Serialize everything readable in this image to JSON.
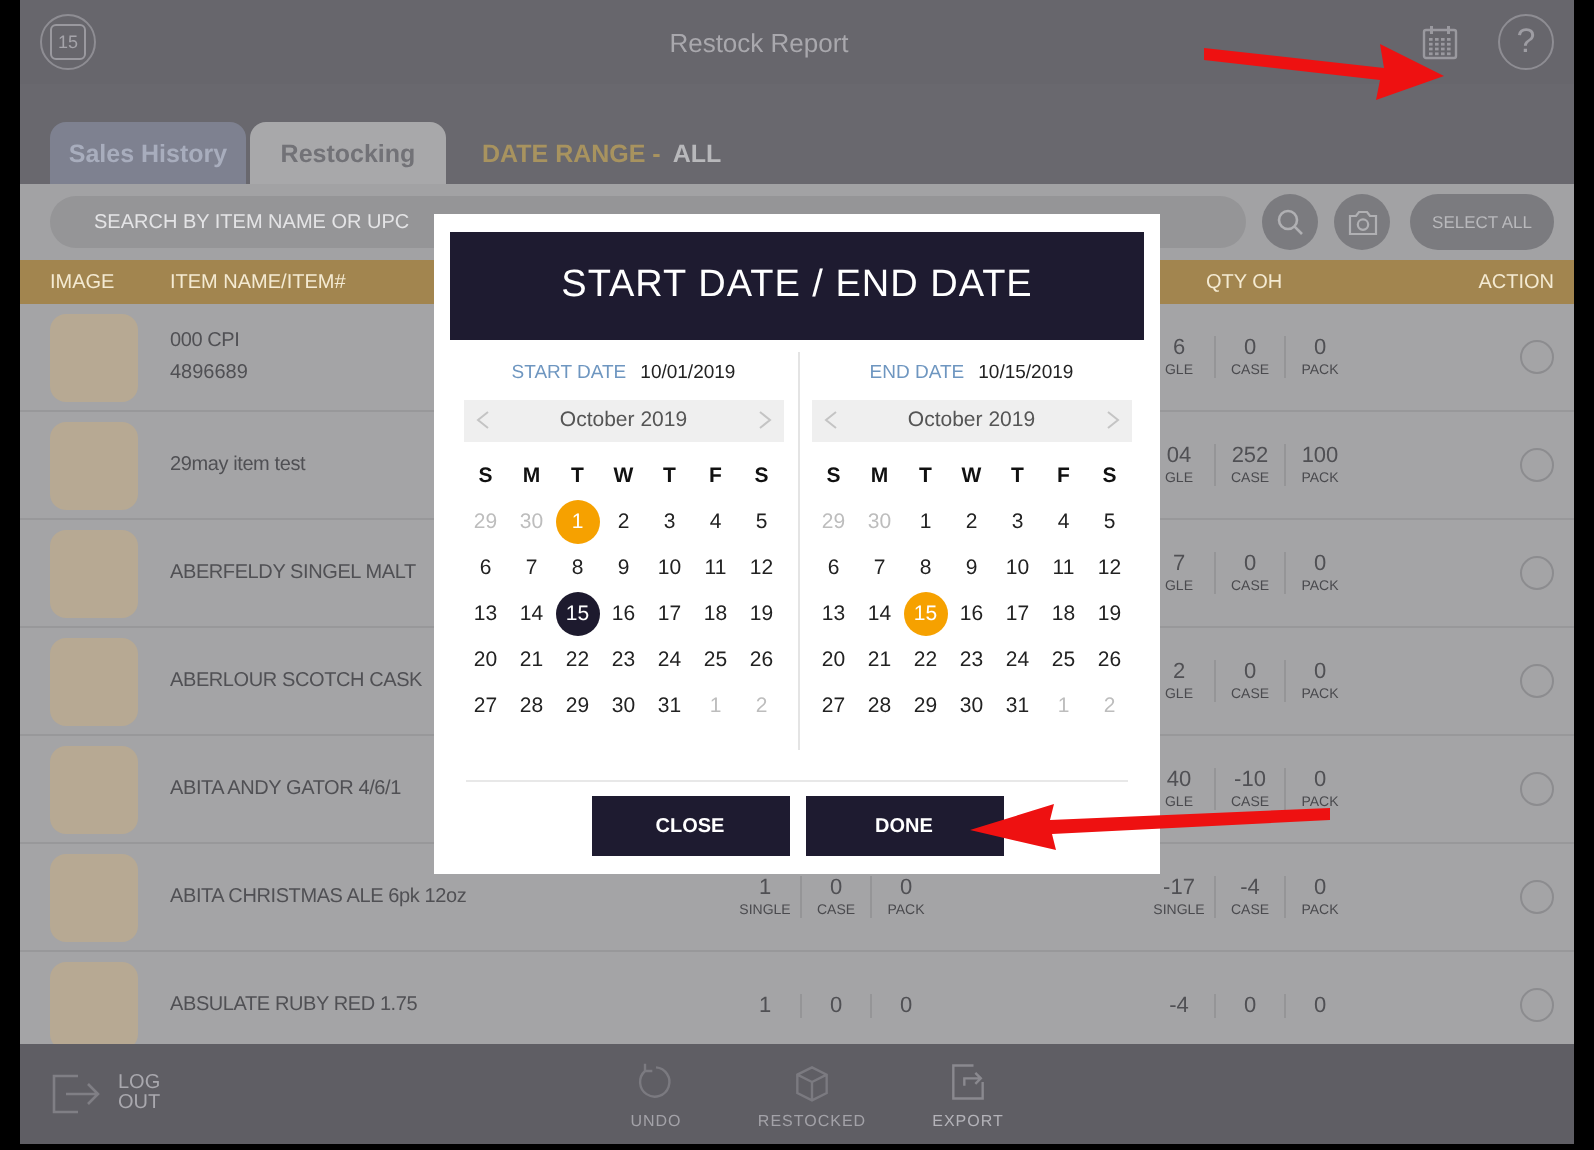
{
  "header": {
    "calendar_day": "15",
    "title": "Restock Report",
    "help": "?"
  },
  "tabs": [
    {
      "label": "Sales History",
      "selected": false
    },
    {
      "label": "Restocking",
      "selected": true
    }
  ],
  "date_range": {
    "label": "DATE RANGE -",
    "value": "ALL"
  },
  "search": {
    "placeholder": "SEARCH BY ITEM NAME OR UPC",
    "select_all": "SELECT ALL"
  },
  "table": {
    "columns": [
      "IMAGE",
      "ITEM NAME/ITEM#",
      "QTY OH",
      "ACTION"
    ],
    "rows": [
      {
        "selected": false,
        "name": "000 CPI",
        "number": "4896689",
        "left_qty": [],
        "right_qty": [
          {
            "value": "6",
            "label": "GLE"
          },
          {
            "value": "0",
            "label": "CASE"
          },
          {
            "value": "0",
            "label": "PACK"
          }
        ]
      },
      {
        "selected": false,
        "name": "29may item test",
        "left_qty": [],
        "right_qty": [
          {
            "value": "04",
            "label": "GLE"
          },
          {
            "value": "252",
            "label": "CASE"
          },
          {
            "value": "100",
            "label": "PACK"
          }
        ]
      },
      {
        "selected": false,
        "name": "ABERFELDY SINGEL MALT",
        "left_qty": [],
        "right_qty": [
          {
            "value": "7",
            "label": "GLE"
          },
          {
            "value": "0",
            "label": "CASE"
          },
          {
            "value": "0",
            "label": "PACK"
          }
        ]
      },
      {
        "selected": false,
        "name": "ABERLOUR SCOTCH  CASK",
        "left_qty": [],
        "right_qty": [
          {
            "value": "2",
            "label": "GLE"
          },
          {
            "value": "0",
            "label": "CASE"
          },
          {
            "value": "0",
            "label": "PACK"
          }
        ]
      },
      {
        "selected": false,
        "name": "ABITA ANDY GATOR 4/6/1",
        "left_qty": [],
        "right_qty": [
          {
            "value": "40",
            "label": "GLE"
          },
          {
            "value": "-10",
            "label": "CASE"
          },
          {
            "value": "0",
            "label": "PACK"
          }
        ]
      },
      {
        "selected": false,
        "name": "ABITA CHRISTMAS  ALE 6pk 12oz",
        "left_qty": [
          {
            "value": "1",
            "label": "SINGLE"
          },
          {
            "value": "0",
            "label": "CASE"
          },
          {
            "value": "0",
            "label": "PACK"
          }
        ],
        "right_qty": [
          {
            "value": "-17",
            "label": "SINGLE"
          },
          {
            "value": "-4",
            "label": "CASE"
          },
          {
            "value": "0",
            "label": "PACK"
          }
        ]
      },
      {
        "selected": false,
        "name": "ABSULATE RUBY RED 1.75",
        "left_qty": [
          {
            "value": "1"
          },
          {
            "value": "0"
          },
          {
            "value": "0"
          }
        ],
        "right_qty": [
          {
            "value": "-4"
          },
          {
            "value": "0"
          },
          {
            "value": "0"
          }
        ]
      }
    ]
  },
  "dialog": {
    "title": "START DATE / END DATE",
    "calendars": [
      {
        "label": "START DATE",
        "value": "10/01/2019",
        "month": "October 2019",
        "weekdays": [
          "S",
          "M",
          "T",
          "W",
          "T",
          "F",
          "S"
        ],
        "days": [
          {
            "day": "29",
            "outside": true,
            "selected": false,
            "today": false
          },
          {
            "day": "30",
            "outside": true,
            "selected": false,
            "today": false
          },
          {
            "day": "1",
            "outside": false,
            "selected": true,
            "today": false
          },
          {
            "day": "2",
            "outside": false,
            "selected": false,
            "today": false
          },
          {
            "day": "3",
            "outside": false,
            "selected": false,
            "today": false
          },
          {
            "day": "4",
            "outside": false,
            "selected": false,
            "today": false
          },
          {
            "day": "5",
            "outside": false,
            "selected": false,
            "today": false
          },
          {
            "day": "6",
            "outside": false,
            "selected": false,
            "today": false
          },
          {
            "day": "7",
            "outside": false,
            "selected": false,
            "today": false
          },
          {
            "day": "8",
            "outside": false,
            "selected": false,
            "today": false
          },
          {
            "day": "9",
            "outside": false,
            "selected": false,
            "today": false
          },
          {
            "day": "10",
            "outside": false,
            "selected": false,
            "today": false
          },
          {
            "day": "11",
            "outside": false,
            "selected": false,
            "today": false
          },
          {
            "day": "12",
            "outside": false,
            "selected": false,
            "today": false
          },
          {
            "day": "13",
            "outside": false,
            "selected": false,
            "today": false
          },
          {
            "day": "14",
            "outside": false,
            "selected": false,
            "today": false
          },
          {
            "day": "15",
            "outside": false,
            "selected": false,
            "today": true
          },
          {
            "day": "16",
            "outside": false,
            "selected": false,
            "today": false
          },
          {
            "day": "17",
            "outside": false,
            "selected": false,
            "today": false
          },
          {
            "day": "18",
            "outside": false,
            "selected": false,
            "today": false
          },
          {
            "day": "19",
            "outside": false,
            "selected": false,
            "today": false
          },
          {
            "day": "20",
            "outside": false,
            "selected": false,
            "today": false
          },
          {
            "day": "21",
            "outside": false,
            "selected": false,
            "today": false
          },
          {
            "day": "22",
            "outside": false,
            "selected": false,
            "today": false
          },
          {
            "day": "23",
            "outside": false,
            "selected": false,
            "today": false
          },
          {
            "day": "24",
            "outside": false,
            "selected": false,
            "today": false
          },
          {
            "day": "25",
            "outside": false,
            "selected": false,
            "today": false
          },
          {
            "day": "26",
            "outside": false,
            "selected": false,
            "today": false
          },
          {
            "day": "27",
            "outside": false,
            "selected": false,
            "today": false
          },
          {
            "day": "28",
            "outside": false,
            "selected": false,
            "today": false
          },
          {
            "day": "29",
            "outside": false,
            "selected": false,
            "today": false
          },
          {
            "day": "30",
            "outside": false,
            "selected": false,
            "today": false
          },
          {
            "day": "31",
            "outside": false,
            "selected": false,
            "today": false
          },
          {
            "day": "1",
            "outside": true,
            "selected": false,
            "today": false
          },
          {
            "day": "2",
            "outside": true,
            "selected": false,
            "today": false
          }
        ]
      },
      {
        "label": "END DATE",
        "value": "10/15/2019",
        "month": "October 2019",
        "weekdays": [
          "S",
          "M",
          "T",
          "W",
          "T",
          "F",
          "S"
        ],
        "days": [
          {
            "day": "29",
            "outside": true,
            "selected": false,
            "today": false
          },
          {
            "day": "30",
            "outside": true,
            "selected": false,
            "today": false
          },
          {
            "day": "1",
            "outside": false,
            "selected": false,
            "today": false
          },
          {
            "day": "2",
            "outside": false,
            "selected": false,
            "today": false
          },
          {
            "day": "3",
            "outside": false,
            "selected": false,
            "today": false
          },
          {
            "day": "4",
            "outside": false,
            "selected": false,
            "today": false
          },
          {
            "day": "5",
            "outside": false,
            "selected": false,
            "today": false
          },
          {
            "day": "6",
            "outside": false,
            "selected": false,
            "today": false
          },
          {
            "day": "7",
            "outside": false,
            "selected": false,
            "today": false
          },
          {
            "day": "8",
            "outside": false,
            "selected": false,
            "today": false
          },
          {
            "day": "9",
            "outside": false,
            "selected": false,
            "today": false
          },
          {
            "day": "10",
            "outside": false,
            "selected": false,
            "today": false
          },
          {
            "day": "11",
            "outside": false,
            "selected": false,
            "today": false
          },
          {
            "day": "12",
            "outside": false,
            "selected": false,
            "today": false
          },
          {
            "day": "13",
            "outside": false,
            "selected": false,
            "today": false
          },
          {
            "day": "14",
            "outside": false,
            "selected": false,
            "today": false
          },
          {
            "day": "15",
            "outside": false,
            "selected": true,
            "today": false
          },
          {
            "day": "16",
            "outside": false,
            "selected": false,
            "today": false
          },
          {
            "day": "17",
            "outside": false,
            "selected": false,
            "today": false
          },
          {
            "day": "18",
            "outside": false,
            "selected": false,
            "today": false
          },
          {
            "day": "19",
            "outside": false,
            "selected": false,
            "today": false
          },
          {
            "day": "20",
            "outside": false,
            "selected": false,
            "today": false
          },
          {
            "day": "21",
            "outside": false,
            "selected": false,
            "today": false
          },
          {
            "day": "22",
            "outside": false,
            "selected": false,
            "today": false
          },
          {
            "day": "23",
            "outside": false,
            "selected": false,
            "today": false
          },
          {
            "day": "24",
            "outside": false,
            "selected": false,
            "today": false
          },
          {
            "day": "25",
            "outside": false,
            "selected": false,
            "today": false
          },
          {
            "day": "26",
            "outside": false,
            "selected": false,
            "today": false
          },
          {
            "day": "27",
            "outside": false,
            "selected": false,
            "today": false
          },
          {
            "day": "28",
            "outside": false,
            "selected": false,
            "today": false
          },
          {
            "day": "29",
            "outside": false,
            "selected": false,
            "today": false
          },
          {
            "day": "30",
            "outside": false,
            "selected": false,
            "today": false
          },
          {
            "day": "31",
            "outside": false,
            "selected": false,
            "today": false
          },
          {
            "day": "1",
            "outside": true,
            "selected": false,
            "today": false
          },
          {
            "day": "2",
            "outside": true,
            "selected": false,
            "today": false
          }
        ]
      }
    ],
    "buttons": [
      "CLOSE",
      "DONE"
    ]
  },
  "bottom_bar": {
    "logout": "LOG OUT",
    "actions": [
      {
        "kind": "undo",
        "label": "UNDO"
      },
      {
        "kind": "restocked",
        "label": "RESTOCKED"
      },
      {
        "kind": "export",
        "label": "EXPORT"
      }
    ]
  }
}
